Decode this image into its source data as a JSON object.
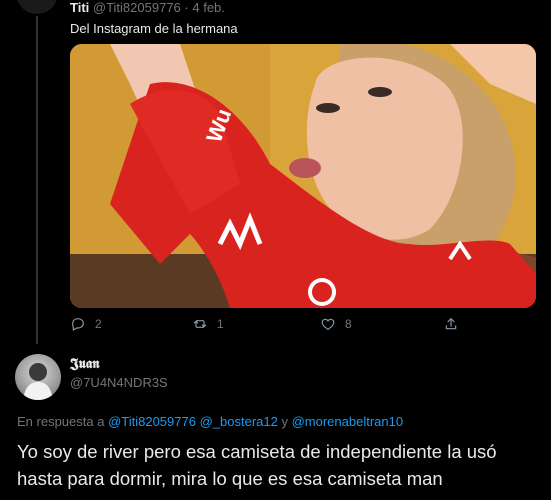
{
  "tweet": {
    "author_name": "Titi",
    "author_handle": "@Titi82059776",
    "separator": "·",
    "date": "4 feb.",
    "text": "Del Instagram de la hermana",
    "image_alt": "photo",
    "actions": {
      "reply_count": "2",
      "retweet_count": "1",
      "like_count": "8"
    }
  },
  "reply": {
    "author_name": "𝕵𝖚𝖆𝖓",
    "author_handle": "@7U4N4NDR3S",
    "replying_prefix": "En respuesta a",
    "mention1": "@Titi82059776",
    "mention2": "@_bostera12",
    "conjunction": "y",
    "mention3": "@morenabeltran10",
    "text": "Yo soy de river pero esa camiseta de independiente la usó hasta para dormir, mira lo que es esa camiseta man"
  },
  "colors": {
    "background": "#000000",
    "text": "#e7e9ea",
    "muted": "#71767b",
    "link": "#1d9bf0",
    "jersey": "#d8231f"
  },
  "icons": [
    "reply-icon",
    "retweet-icon",
    "like-icon",
    "share-icon"
  ]
}
